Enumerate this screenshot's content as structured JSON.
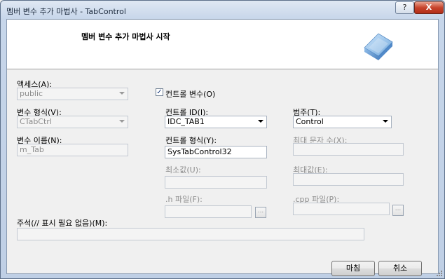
{
  "window": {
    "title": "멤버 변수 추가 마법사 - TabControl",
    "help": "?",
    "close": "X"
  },
  "header": {
    "title": "멤버 변수 추가 마법사 시작"
  },
  "form": {
    "access": {
      "label": "액세스(A):",
      "value": "public"
    },
    "control_var": {
      "label": "컨트롤 변수(O)",
      "checked": true,
      "checkmark": "✓"
    },
    "var_type": {
      "label": "변수 형식(V):",
      "value": "CTabCtrl"
    },
    "control_id": {
      "label": "컨트롤 ID(I):",
      "value": "IDC_TAB1"
    },
    "category": {
      "label": "범주(T):",
      "value": "Control"
    },
    "var_name": {
      "label": "변수 이름(N):",
      "value": "m_Tab"
    },
    "control_type": {
      "label": "컨트롤 형식(Y):",
      "value": "SysTabControl32"
    },
    "max_chars": {
      "label": "최대 문자 수(X):",
      "value": ""
    },
    "min_value": {
      "label": "최소값(U):",
      "value": ""
    },
    "max_value": {
      "label": "최대값(E):",
      "value": ""
    },
    "h_file": {
      "label": ".h 파일(F):",
      "value": "",
      "browse": "..."
    },
    "cpp_file": {
      "label": ".cpp 파일(P):",
      "value": "",
      "browse": "..."
    },
    "comment": {
      "label": "주석(// 표시 필요 없음)(M):",
      "value": ""
    }
  },
  "buttons": {
    "finish": "마침",
    "cancel": "취소"
  }
}
